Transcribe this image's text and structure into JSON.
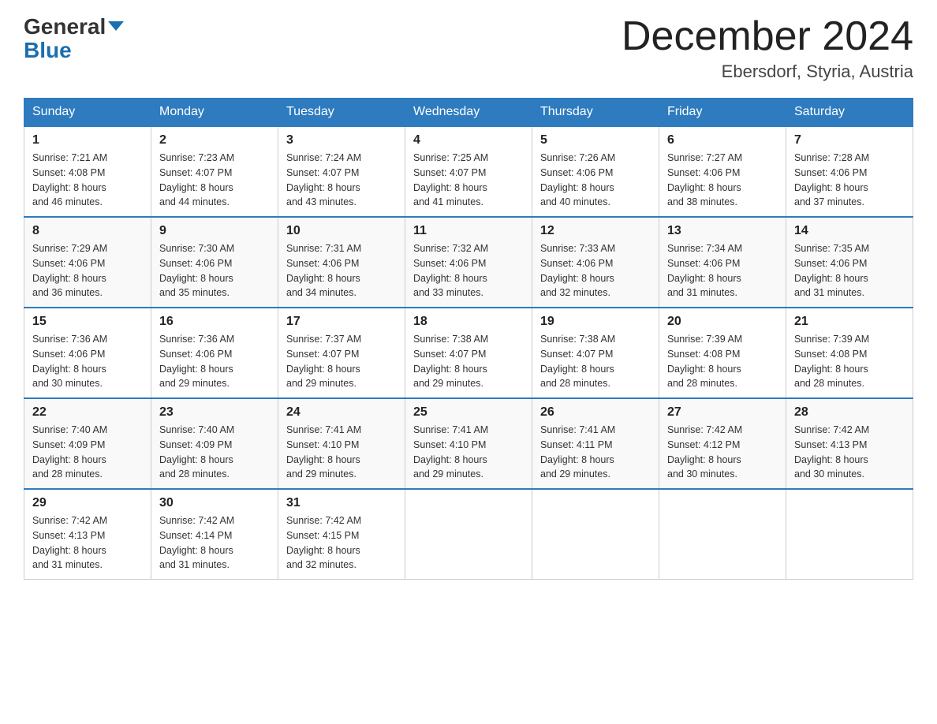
{
  "header": {
    "logo_line1": "General",
    "logo_line2": "Blue",
    "month_title": "December 2024",
    "location": "Ebersdorf, Styria, Austria"
  },
  "days_of_week": [
    "Sunday",
    "Monday",
    "Tuesday",
    "Wednesday",
    "Thursday",
    "Friday",
    "Saturday"
  ],
  "weeks": [
    [
      {
        "day": "1",
        "sunrise": "7:21 AM",
        "sunset": "4:08 PM",
        "daylight": "8 hours and 46 minutes."
      },
      {
        "day": "2",
        "sunrise": "7:23 AM",
        "sunset": "4:07 PM",
        "daylight": "8 hours and 44 minutes."
      },
      {
        "day": "3",
        "sunrise": "7:24 AM",
        "sunset": "4:07 PM",
        "daylight": "8 hours and 43 minutes."
      },
      {
        "day": "4",
        "sunrise": "7:25 AM",
        "sunset": "4:07 PM",
        "daylight": "8 hours and 41 minutes."
      },
      {
        "day": "5",
        "sunrise": "7:26 AM",
        "sunset": "4:06 PM",
        "daylight": "8 hours and 40 minutes."
      },
      {
        "day": "6",
        "sunrise": "7:27 AM",
        "sunset": "4:06 PM",
        "daylight": "8 hours and 38 minutes."
      },
      {
        "day": "7",
        "sunrise": "7:28 AM",
        "sunset": "4:06 PM",
        "daylight": "8 hours and 37 minutes."
      }
    ],
    [
      {
        "day": "8",
        "sunrise": "7:29 AM",
        "sunset": "4:06 PM",
        "daylight": "8 hours and 36 minutes."
      },
      {
        "day": "9",
        "sunrise": "7:30 AM",
        "sunset": "4:06 PM",
        "daylight": "8 hours and 35 minutes."
      },
      {
        "day": "10",
        "sunrise": "7:31 AM",
        "sunset": "4:06 PM",
        "daylight": "8 hours and 34 minutes."
      },
      {
        "day": "11",
        "sunrise": "7:32 AM",
        "sunset": "4:06 PM",
        "daylight": "8 hours and 33 minutes."
      },
      {
        "day": "12",
        "sunrise": "7:33 AM",
        "sunset": "4:06 PM",
        "daylight": "8 hours and 32 minutes."
      },
      {
        "day": "13",
        "sunrise": "7:34 AM",
        "sunset": "4:06 PM",
        "daylight": "8 hours and 31 minutes."
      },
      {
        "day": "14",
        "sunrise": "7:35 AM",
        "sunset": "4:06 PM",
        "daylight": "8 hours and 31 minutes."
      }
    ],
    [
      {
        "day": "15",
        "sunrise": "7:36 AM",
        "sunset": "4:06 PM",
        "daylight": "8 hours and 30 minutes."
      },
      {
        "day": "16",
        "sunrise": "7:36 AM",
        "sunset": "4:06 PM",
        "daylight": "8 hours and 29 minutes."
      },
      {
        "day": "17",
        "sunrise": "7:37 AM",
        "sunset": "4:07 PM",
        "daylight": "8 hours and 29 minutes."
      },
      {
        "day": "18",
        "sunrise": "7:38 AM",
        "sunset": "4:07 PM",
        "daylight": "8 hours and 29 minutes."
      },
      {
        "day": "19",
        "sunrise": "7:38 AM",
        "sunset": "4:07 PM",
        "daylight": "8 hours and 28 minutes."
      },
      {
        "day": "20",
        "sunrise": "7:39 AM",
        "sunset": "4:08 PM",
        "daylight": "8 hours and 28 minutes."
      },
      {
        "day": "21",
        "sunrise": "7:39 AM",
        "sunset": "4:08 PM",
        "daylight": "8 hours and 28 minutes."
      }
    ],
    [
      {
        "day": "22",
        "sunrise": "7:40 AM",
        "sunset": "4:09 PM",
        "daylight": "8 hours and 28 minutes."
      },
      {
        "day": "23",
        "sunrise": "7:40 AM",
        "sunset": "4:09 PM",
        "daylight": "8 hours and 28 minutes."
      },
      {
        "day": "24",
        "sunrise": "7:41 AM",
        "sunset": "4:10 PM",
        "daylight": "8 hours and 29 minutes."
      },
      {
        "day": "25",
        "sunrise": "7:41 AM",
        "sunset": "4:10 PM",
        "daylight": "8 hours and 29 minutes."
      },
      {
        "day": "26",
        "sunrise": "7:41 AM",
        "sunset": "4:11 PM",
        "daylight": "8 hours and 29 minutes."
      },
      {
        "day": "27",
        "sunrise": "7:42 AM",
        "sunset": "4:12 PM",
        "daylight": "8 hours and 30 minutes."
      },
      {
        "day": "28",
        "sunrise": "7:42 AM",
        "sunset": "4:13 PM",
        "daylight": "8 hours and 30 minutes."
      }
    ],
    [
      {
        "day": "29",
        "sunrise": "7:42 AM",
        "sunset": "4:13 PM",
        "daylight": "8 hours and 31 minutes."
      },
      {
        "day": "30",
        "sunrise": "7:42 AM",
        "sunset": "4:14 PM",
        "daylight": "8 hours and 31 minutes."
      },
      {
        "day": "31",
        "sunrise": "7:42 AM",
        "sunset": "4:15 PM",
        "daylight": "8 hours and 32 minutes."
      },
      null,
      null,
      null,
      null
    ]
  ],
  "labels": {
    "sunrise": "Sunrise:",
    "sunset": "Sunset:",
    "daylight": "Daylight:"
  }
}
